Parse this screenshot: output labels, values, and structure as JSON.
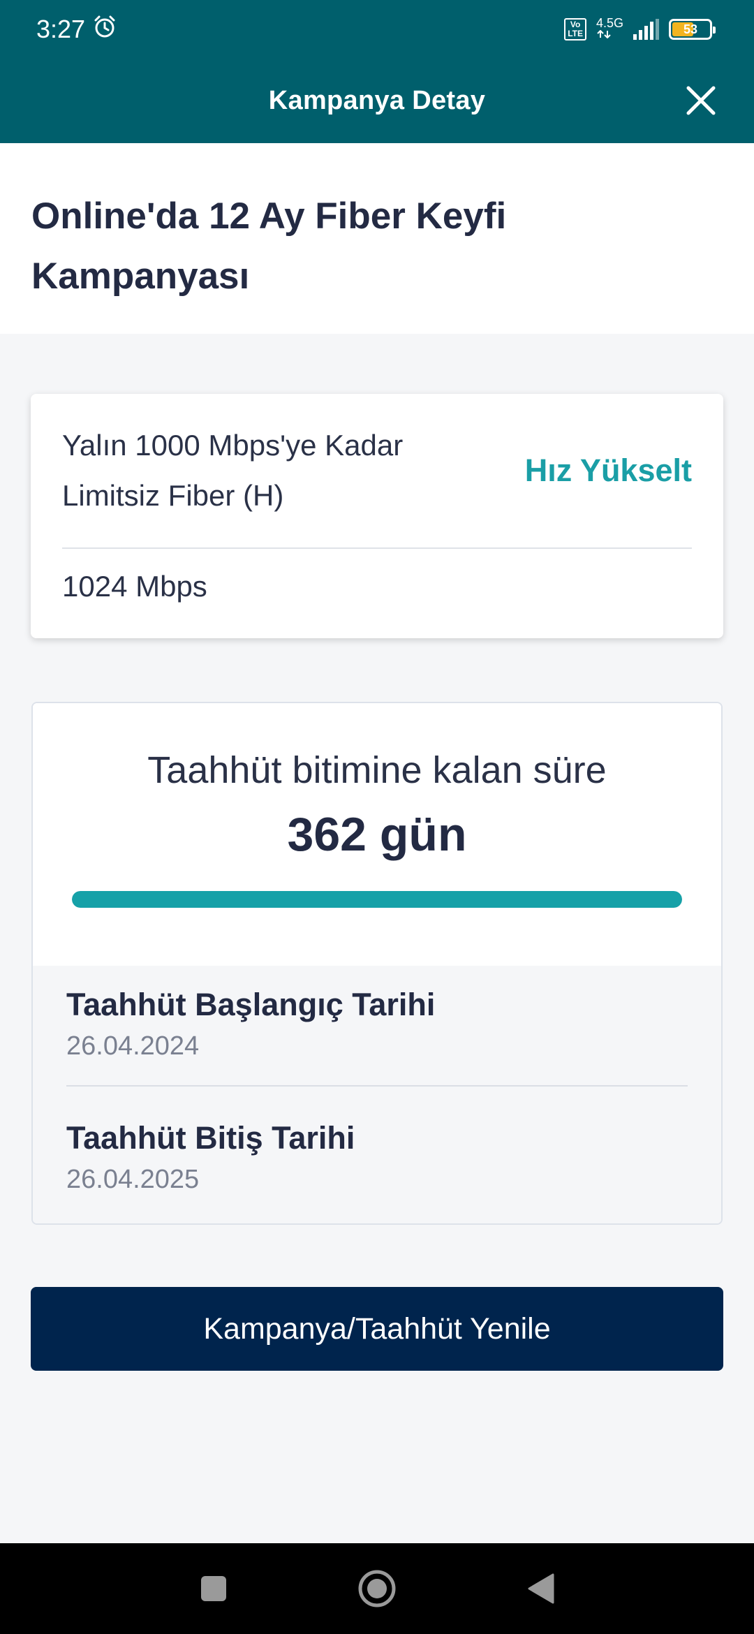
{
  "status_bar": {
    "time": "3:27",
    "volte_top": "Vo",
    "volte_bottom": "LTE",
    "network": "4.5G",
    "battery": "53",
    "battery_level": 0.53
  },
  "app_bar": {
    "title": "Kampanya Detay"
  },
  "campaign": {
    "title": "Online'da 12 Ay Fiber Keyfi Kampanyası"
  },
  "speed_card": {
    "package_name": "Yalın 1000 Mbps'ye Kadar Limitsiz Fiber (H)",
    "upgrade_label": "Hız Yükselt",
    "speed": "1024 Mbps"
  },
  "commitment": {
    "remaining_label": "Taahhüt bitimine kalan süre",
    "remaining_value": "362 gün",
    "progress_percent": 100,
    "start_label": "Taahhüt Başlangıç Tarihi",
    "start_date": "26.04.2024",
    "end_label": "Taahhüt Bitiş Tarihi",
    "end_date": "26.04.2025"
  },
  "actions": {
    "renew_label": "Kampanya/Taahhüt Yenile"
  },
  "colors": {
    "header": "#005f6c",
    "accent": "#16a1a8",
    "primary_button": "#00244d"
  }
}
